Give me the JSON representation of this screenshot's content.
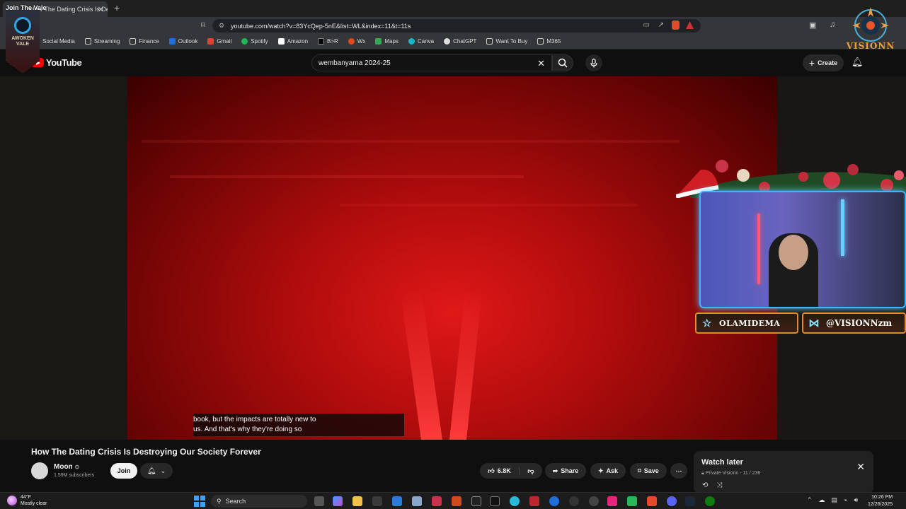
{
  "browser": {
    "tab_title": "How The Dating Crisis Is Destroying",
    "url": "youtube.com/watch?v=83YcQep-5nE&list=WL&index=11&t=11s",
    "bookmarks": [
      "Social Media",
      "Streaming",
      "Finance",
      "Outlook",
      "Gmail",
      "Spotify",
      "Amazon",
      "B>R",
      "Wx",
      "Maps",
      "Canva",
      "ChatGPT",
      "Want To Buy",
      "M365"
    ]
  },
  "youtube": {
    "logo_text": "YouTube",
    "search_value": "wembanyama 2024-25",
    "create_label": "Create"
  },
  "video": {
    "subtitle_line1": "book, but the impacts are totally new to",
    "subtitle_line2": "us. And that's why they're doing so",
    "title": "How The Dating Crisis Is Destroying Our Society Forever",
    "channel": "Moon",
    "subscribers": "1.59M subscribers",
    "join_label": "Join",
    "likes": "6.8K",
    "share_label": "Share",
    "ask_label": "Ask",
    "save_label": "Save"
  },
  "watch_later": {
    "title": "Watch later",
    "privacy": "Private",
    "owner": "Visionn",
    "position": "11 / 236"
  },
  "overlay": {
    "banner_text": "Join The Vale",
    "vale_text": "AWOKEN VALE",
    "streamer_logo_text": "VISIONN",
    "tag_left": "OLAMIDEMA",
    "tag_right": "@VISIONNzm"
  },
  "taskbar": {
    "temperature": "44°F",
    "weather_desc": "Mostly clear",
    "search_label": "Search",
    "time": "10:26 PM",
    "date": "12/26/2025"
  }
}
